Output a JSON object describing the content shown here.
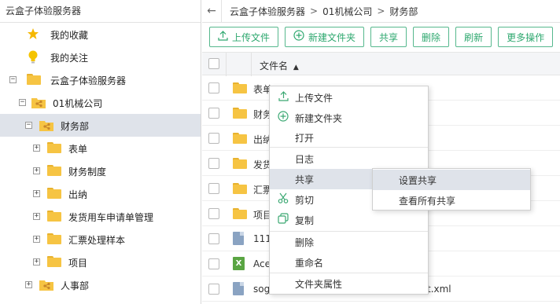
{
  "left": {
    "breadcrumb": "云盒子体验服务器",
    "tree": [
      {
        "label": "我的收藏",
        "icon": "star-icon"
      },
      {
        "label": "我的关注",
        "icon": "bulb-icon"
      },
      {
        "label": "云盒子体验服务器",
        "icon": "folder-icon",
        "toggle": "−"
      },
      {
        "label": "01机械公司",
        "icon": "shared-folder-icon",
        "toggle": "−"
      },
      {
        "label": "财务部",
        "icon": "shared-folder-icon",
        "toggle": "−"
      },
      {
        "label": "表单",
        "icon": "folder-icon",
        "toggle": "+"
      },
      {
        "label": "财务制度",
        "icon": "folder-icon",
        "toggle": "+"
      },
      {
        "label": "出纳",
        "icon": "folder-icon",
        "toggle": "+"
      },
      {
        "label": "发货用车申请单管理",
        "icon": "folder-icon",
        "toggle": "+"
      },
      {
        "label": "汇票处理样本",
        "icon": "folder-icon",
        "toggle": "+"
      },
      {
        "label": "项目",
        "icon": "folder-icon",
        "toggle": "+"
      },
      {
        "label": "人事部",
        "icon": "shared-folder-icon",
        "toggle": "+"
      }
    ]
  },
  "topbar": {
    "back": "←",
    "crumbs": [
      "云盒子体验服务器",
      "01机械公司",
      "财务部"
    ],
    "sep": ">"
  },
  "toolbar": {
    "upload": "上传文件",
    "new_folder": "新建文件夹",
    "share": "共享",
    "delete": "删除",
    "refresh": "刷新",
    "more": "更多操作"
  },
  "table": {
    "col_name": "文件名",
    "sort_arrow": "▲",
    "rows": [
      {
        "name": "表单",
        "type": "folder"
      },
      {
        "name": "财务",
        "type": "folder"
      },
      {
        "name": "出纳",
        "type": "folder"
      },
      {
        "name": "发货",
        "type": "folder"
      },
      {
        "name": "汇票",
        "type": "folder"
      },
      {
        "name": "项目",
        "type": "folder"
      },
      {
        "name": "111",
        "type": "doc"
      },
      {
        "name": "Ace",
        "type": "xls"
      },
      {
        "name": "sog",
        "type": "doc",
        "suffix": "t.xml"
      }
    ]
  },
  "menu": {
    "upload": "上传文件",
    "new_folder": "新建文件夹",
    "open": "打开",
    "log": "日志",
    "share": "共享",
    "cut": "剪切",
    "copy": "复制",
    "delete": "删除",
    "rename": "重命名",
    "properties": "文件夹属性"
  },
  "submenu": {
    "set_share": "设置共享",
    "view_all_shares": "查看所有共享"
  },
  "colors": {
    "accent": "#2ea86f",
    "folder": "#f6c443",
    "selection": "#dfe3ea"
  }
}
